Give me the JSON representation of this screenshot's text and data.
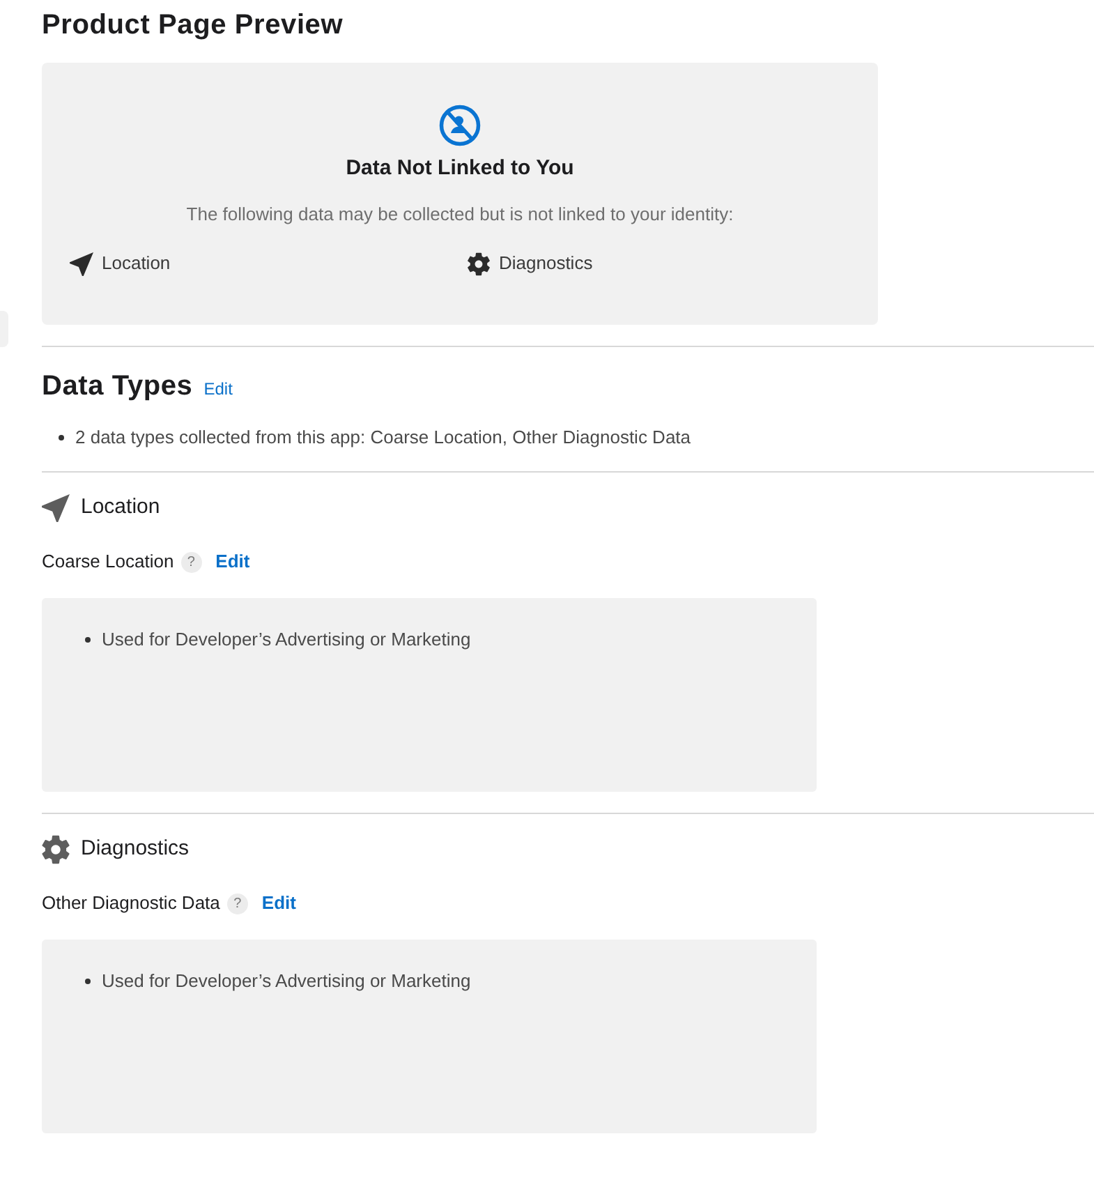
{
  "page_title": "Product Page Preview",
  "preview_card": {
    "title": "Data Not Linked to You",
    "description": "The following data may be collected but is not linked to your identity:",
    "categories": [
      {
        "kind": "location",
        "label": "Location"
      },
      {
        "kind": "diagnostics",
        "label": "Diagnostics"
      }
    ]
  },
  "data_types": {
    "heading": "Data Types",
    "edit_link": "Edit",
    "summary": [
      "2 data types collected from this app: Coarse Location, Other Diagnostic Data"
    ]
  },
  "sections": [
    {
      "kind": "location",
      "heading": "Location",
      "items": [
        {
          "name": "Coarse Location",
          "help": "?",
          "edit_link": "Edit",
          "purposes": [
            "Used for Developer’s Advertising or Marketing"
          ]
        }
      ]
    },
    {
      "kind": "diagnostics",
      "heading": "Diagnostics",
      "items": [
        {
          "name": "Other Diagnostic Data",
          "help": "?",
          "edit_link": "Edit",
          "purposes": [
            "Used for Developer’s Advertising or Marketing"
          ]
        }
      ]
    }
  ]
}
